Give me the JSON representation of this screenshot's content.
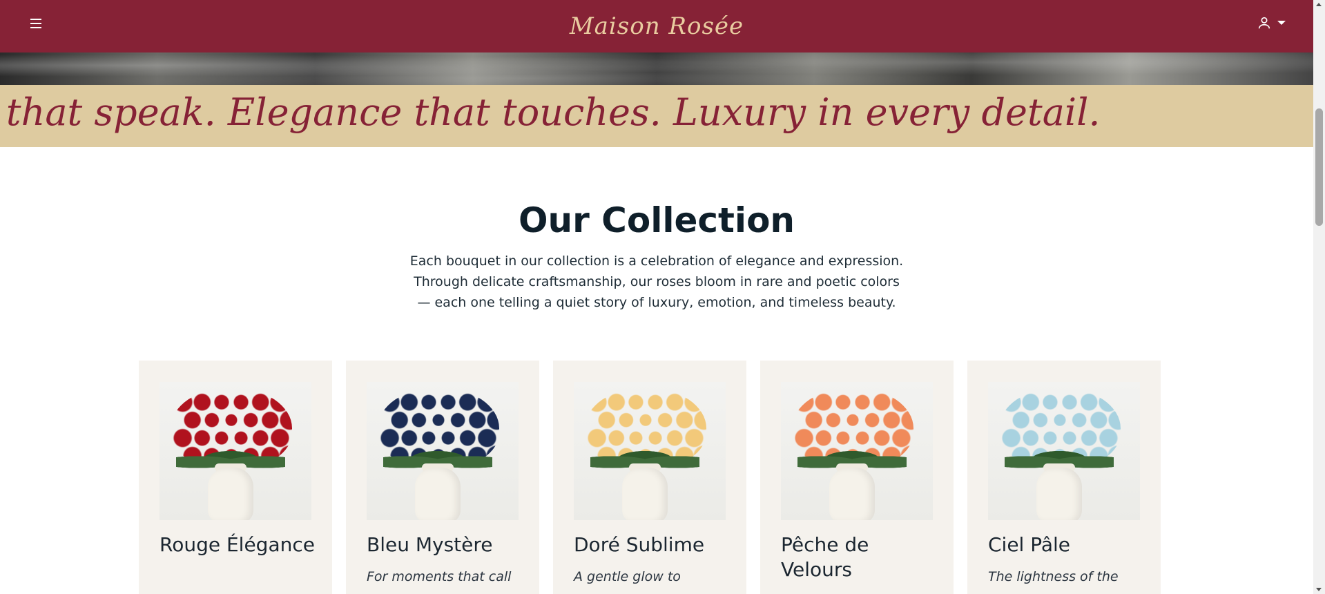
{
  "header": {
    "brand": "Maison Rosée",
    "menu_icon": "hamburger-menu-icon",
    "account_icon": "user-icon",
    "account_caret_icon": "caret-down-icon",
    "color": "#862236",
    "brand_color": "#e9cca0"
  },
  "marquee": {
    "text": "s that speak. Elegance that touches. Luxury in every detail.",
    "background": "#decba0"
  },
  "collection": {
    "title": "Our Collection",
    "description_lines": [
      "Each bouquet in our collection is a celebration of elegance and expression.",
      "Through delicate craftsmanship, our roses bloom in rare and poetic colors",
      "— each one telling a quiet story of luxury, emotion, and timeless beauty."
    ]
  },
  "products": [
    {
      "name": "Rouge Élégance",
      "tagline": "",
      "rose_color": "#b0121e"
    },
    {
      "name": "Bleu Mystère",
      "tagline": "For moments that call",
      "rose_color": "#1b2c55"
    },
    {
      "name": "Doré Sublime",
      "tagline": "A gentle glow to",
      "rose_color": "#f2c97a"
    },
    {
      "name": "Pêche de Velours",
      "tagline": "",
      "rose_color": "#f08a5a"
    },
    {
      "name": "Ciel Pâle",
      "tagline": "The lightness of the",
      "rose_color": "#a8d2e0"
    }
  ]
}
